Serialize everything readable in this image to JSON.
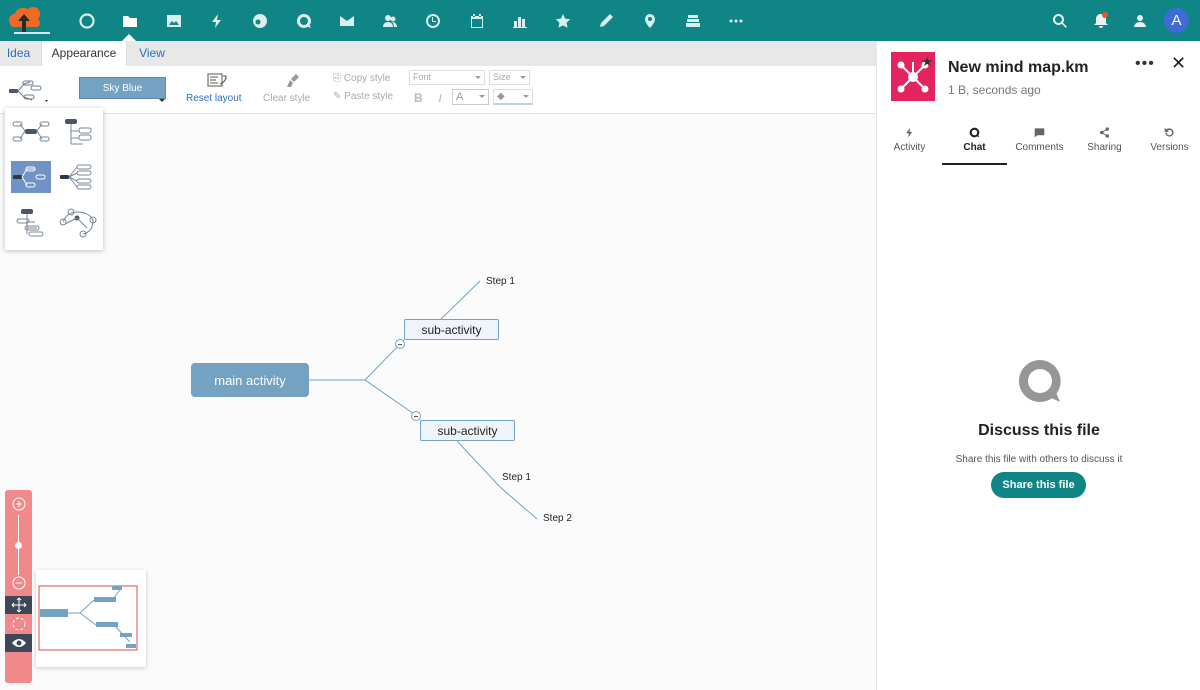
{
  "topbar": {
    "apps": [
      {
        "name": "dashboard-icon"
      },
      {
        "name": "files-icon"
      },
      {
        "name": "photos-icon"
      },
      {
        "name": "activity-icon"
      },
      {
        "name": "circles-icon"
      },
      {
        "name": "talk-icon"
      },
      {
        "name": "mail-icon"
      },
      {
        "name": "contacts-icon"
      },
      {
        "name": "clock-icon"
      },
      {
        "name": "calendar-icon"
      },
      {
        "name": "analytics-icon"
      },
      {
        "name": "favorites-icon"
      },
      {
        "name": "pencil-icon"
      },
      {
        "name": "maps-icon"
      },
      {
        "name": "deck-icon"
      },
      {
        "name": "more-apps-icon"
      }
    ],
    "avatar_initial": "A",
    "accent_color": "#0f8585"
  },
  "editor": {
    "tabs": [
      "Idea",
      "Appearance",
      "View"
    ],
    "active_tab": "Appearance",
    "toolbar": {
      "theme_label": "Sky Blue",
      "reset_layout": "Reset layout",
      "clear_style": "Clear style",
      "copy_style": "Copy style",
      "paste_style": "Paste style",
      "font_placeholder": "Font",
      "size_placeholder": "Size",
      "bold": "B",
      "italic": "I",
      "font_color": "A"
    }
  },
  "mindmap": {
    "main": "main activity",
    "sub1": "sub-activity",
    "sub1_leaf": "Step 1",
    "sub2": "sub-activity",
    "sub2_leaf1": "Step 1",
    "sub2_leaf2": "Step 2",
    "node_color": "#73a2c2"
  },
  "sidebar": {
    "file_title": "New mind map.km",
    "file_meta": "1 B, seconds ago",
    "tabs": [
      {
        "label": "Activity",
        "icon": "activity-icon"
      },
      {
        "label": "Chat",
        "icon": "chat-icon"
      },
      {
        "label": "Comments",
        "icon": "comments-icon"
      },
      {
        "label": "Sharing",
        "icon": "share-icon"
      },
      {
        "label": "Versions",
        "icon": "history-icon"
      }
    ],
    "active_tab": "Chat",
    "empty_title": "Discuss this file",
    "empty_sub": "Share this file with others to discuss it",
    "share_button": "Share this file",
    "file_color": "#e5245f"
  }
}
